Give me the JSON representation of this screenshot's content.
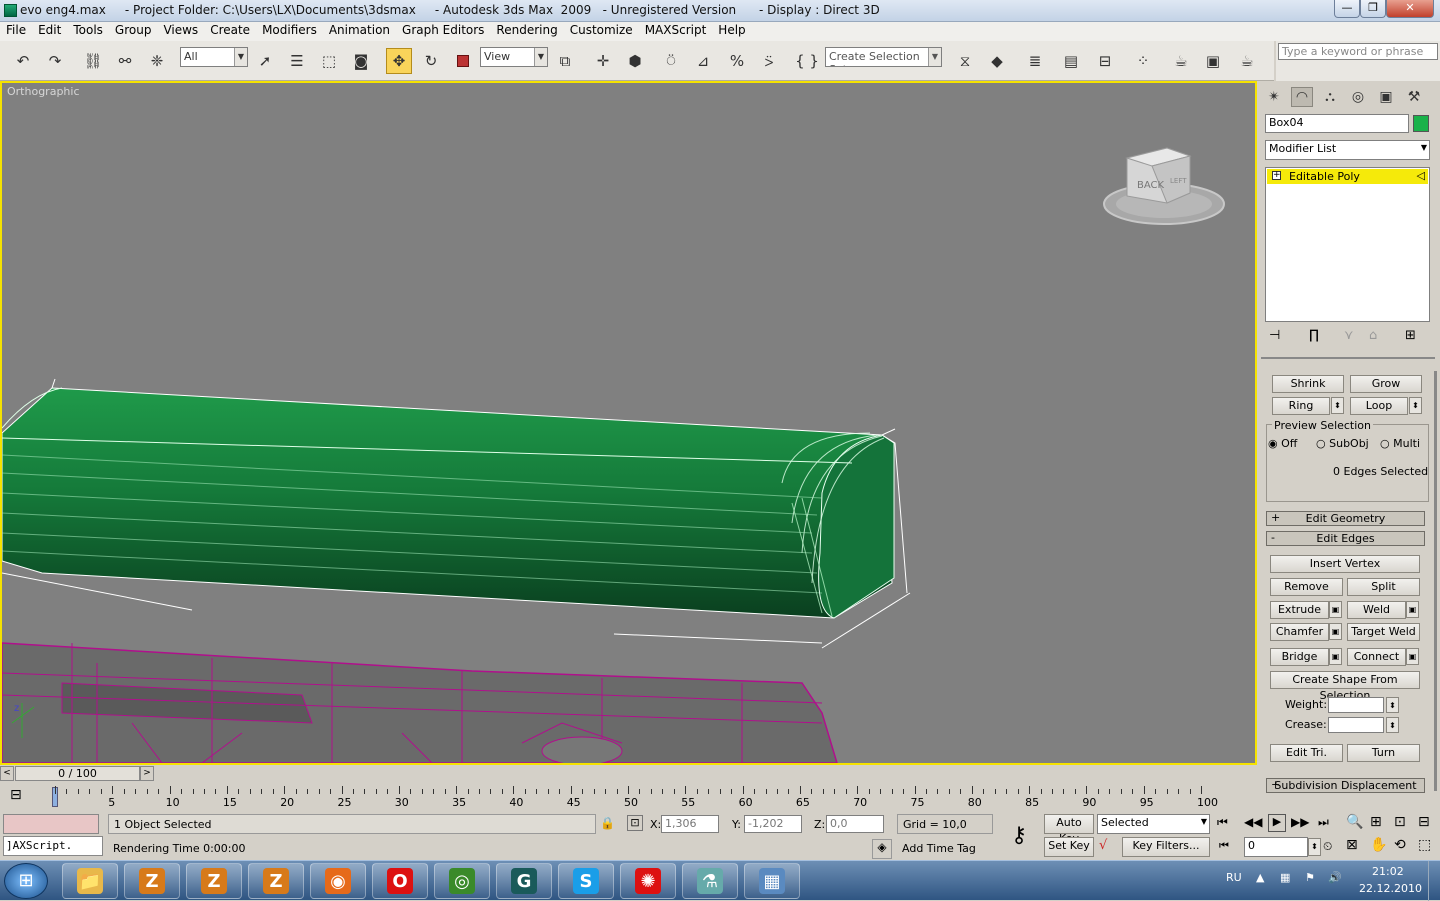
{
  "title": {
    "text": "evo eng4.max     - Project Folder: C:\\Users\\LX\\Documents\\3dsmax     - Autodesk 3ds Max  2009   - Unregistered Version      - Display : Direct 3D"
  },
  "window_buttons": {
    "minimize": "—",
    "maximize": "❐",
    "close": "✕"
  },
  "menu": [
    "File",
    "Edit",
    "Tools",
    "Group",
    "Views",
    "Create",
    "Modifiers",
    "Animation",
    "Graph Editors",
    "Rendering",
    "Customize",
    "MAXScript",
    "Help"
  ],
  "toolbar": {
    "filter_value": "All",
    "ref_coord_value": "View",
    "selection_set_placeholder": "Create Selection Set",
    "search_placeholder": "Type a keyword or phrase"
  },
  "viewport": {
    "label": "Orthographic",
    "viewcube_face": "BACK",
    "viewcube_side": "LEFT"
  },
  "command_panel": {
    "object_name": "Box04",
    "object_color": "#1ab24a",
    "modifier_list": "Modifier List",
    "stack_item": "Editable Poly",
    "selection": {
      "shrink": "Shrink",
      "grow": "Grow",
      "ring": "Ring",
      "loop": "Loop",
      "preview_title": "Preview Selection",
      "preview_options": [
        "Off",
        "SubObj",
        "Multi"
      ],
      "preview_selected": "Off",
      "status": "0 Edges Selected"
    },
    "rollouts": {
      "edit_geometry": "Edit Geometry",
      "edit_edges": "Edit Edges",
      "subdivision": "Subdivision Displacement"
    },
    "edit_edges": {
      "insert_vertex": "Insert Vertex",
      "remove": "Remove",
      "split": "Split",
      "extrude": "Extrude",
      "weld": "Weld",
      "chamfer": "Chamfer",
      "target_weld": "Target Weld",
      "bridge": "Bridge",
      "connect": "Connect",
      "create_shape": "Create Shape From Selection",
      "weight_label": "Weight:",
      "crease_label": "Crease:",
      "edit_tri": "Edit Tri.",
      "turn": "Turn"
    }
  },
  "timeline": {
    "frame_display": "0 / 100",
    "ticks": [
      "5",
      "10",
      "15",
      "20",
      "25",
      "30",
      "35",
      "40",
      "45",
      "50",
      "55",
      "60",
      "65",
      "70",
      "75",
      "80",
      "85",
      "90",
      "95",
      "100"
    ]
  },
  "status": {
    "maxscript": "]AXScript.",
    "selected": "1 Object Selected",
    "rendering_time": "Rendering Time  0:00:00",
    "x_label": "X:",
    "x_value": "1,306",
    "y_label": "Y:",
    "y_value": "-1,202",
    "z_label": "Z:",
    "z_value": "0,0",
    "grid": "Grid = 10,0",
    "add_time_tag": "Add Time Tag",
    "auto_key": "Auto Key",
    "set_key": "Set Key",
    "key_mode": "Selected",
    "key_filters": "Key Filters...",
    "frame_field": "0"
  },
  "taskbar": {
    "tasks": [
      {
        "name": "explorer",
        "glyph": "📁",
        "color": "#e8b84a"
      },
      {
        "name": "app-z1",
        "glyph": "Z",
        "color": "#d77a1a"
      },
      {
        "name": "app-z2",
        "glyph": "Z",
        "color": "#d77a1a"
      },
      {
        "name": "app-z3",
        "glyph": "Z",
        "color": "#d77a1a"
      },
      {
        "name": "firefox",
        "glyph": "◉",
        "color": "#e66a1a"
      },
      {
        "name": "opera",
        "glyph": "O",
        "color": "#d11"
      },
      {
        "name": "chrome",
        "glyph": "◎",
        "color": "#3a8a2a"
      },
      {
        "name": "3dsmax",
        "glyph": "G",
        "color": "#1a5a5a"
      },
      {
        "name": "skype",
        "glyph": "S",
        "color": "#1a9ee8"
      },
      {
        "name": "splat",
        "glyph": "✺",
        "color": "#d11"
      },
      {
        "name": "app-green",
        "glyph": "⚗",
        "color": "#6aa"
      },
      {
        "name": "desktop",
        "glyph": "▦",
        "color": "#5a8ac0"
      }
    ],
    "lang": "RU",
    "time": "21:02",
    "date": "22.12.2010"
  }
}
